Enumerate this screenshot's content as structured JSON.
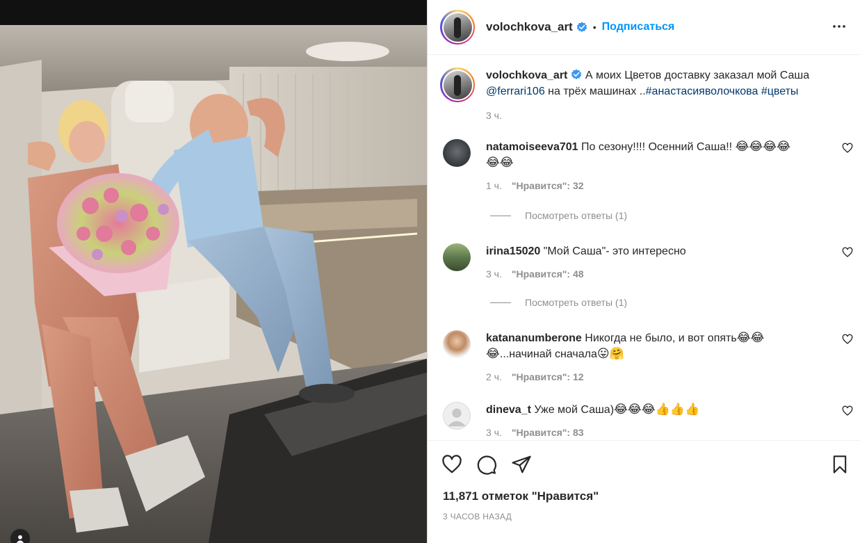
{
  "post": {
    "author": "volochkova_art",
    "follow_label": "Подписаться",
    "dot": "•",
    "more_icon": "more-horizontal-icon"
  },
  "caption": {
    "username": "volochkova_art",
    "text": " А моих Цветов доставку заказал мой Саша ",
    "mention": "@ferrari106",
    "text2": " на трёх машинах ..",
    "tags": "#анастасияволочкова #цветы",
    "time": "3 ч."
  },
  "comments": [
    {
      "username": "natamoiseeva701",
      "text": " По сезону!!!! Осенний Саша!! ",
      "emoji": "😂😂😂😂",
      "emoji2": "😂😂",
      "time": "1 ч.",
      "likes": "\"Нравится\": 32",
      "replies": "Посмотреть ответы (1)"
    },
    {
      "username": "irina15020",
      "text": " \"Мой Саша\"- это интересно",
      "time": "3 ч.",
      "likes": "\"Нравится\": 48",
      "replies": "Посмотреть ответы (1)"
    },
    {
      "username": "katananumberone",
      "text": " Никогда не было, и вот опять",
      "emoji": "😂😂",
      "emoji2": "😂",
      "text2": "...начинай сначала",
      "emoji3": "😛🤗",
      "time": "2 ч.",
      "likes": "\"Нравится\": 12"
    },
    {
      "username": "dineva_t",
      "text": " Уже мой Саша)",
      "emoji": "😂😂😂👍👍👍",
      "time": "3 ч.",
      "likes": "\"Нравится\": 83"
    }
  ],
  "actions": {
    "like_icon": "heart-icon",
    "comment_icon": "comment-icon",
    "share_icon": "send-icon",
    "save_icon": "bookmark-icon"
  },
  "stats": {
    "likes_total": "11,871 отметок \"Нравится\"",
    "time_ago": "3 ЧАСОВ НАЗАД"
  },
  "colors": {
    "link": "#00376b",
    "follow": "#0095f6",
    "muted": "#8e8e8e"
  }
}
